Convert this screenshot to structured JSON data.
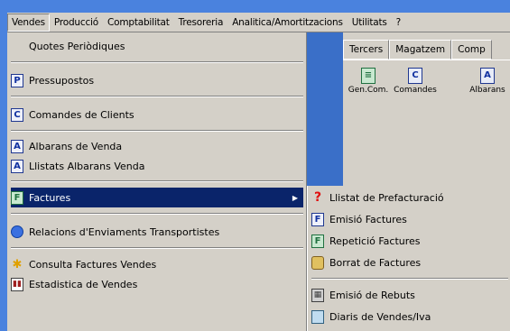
{
  "menubar": {
    "items": [
      {
        "label": "Vendes",
        "active": true
      },
      {
        "label": "Producció"
      },
      {
        "label": "Comptabilitat"
      },
      {
        "label": "Tresoreria"
      },
      {
        "label": "Analitica/Amortitzacions"
      },
      {
        "label": "Utilitats"
      },
      {
        "label": "?"
      }
    ]
  },
  "toolbar": {
    "tabs": [
      "Tercers",
      "Magatzem",
      "Comp"
    ],
    "tools": [
      {
        "label": "Gen.Com.",
        "icon": "generate-commands-icon",
        "glyph": "≡"
      },
      {
        "label": "Comandes",
        "icon": "orders-icon",
        "glyph": "C"
      },
      {
        "label": "Albarans",
        "icon": "delivery-notes-icon",
        "glyph": "A"
      }
    ]
  },
  "vendes_menu": {
    "items": [
      {
        "label": "Quotes Periòdiques",
        "icon": ""
      },
      {
        "label": "Pressupostos",
        "icon": "budget-icon",
        "glyph": "P"
      },
      {
        "label": "Comandes de Clients",
        "icon": "orders-icon",
        "glyph": "C"
      },
      {
        "label": "Albarans de Venda",
        "icon": "delivery-note-icon",
        "glyph": "A"
      },
      {
        "label": "Llistats Albarans Venda",
        "icon": "delivery-list-icon",
        "glyph": "A"
      },
      {
        "label": "Factures",
        "icon": "invoice-icon",
        "glyph": "F",
        "highlighted": true,
        "submenu": true
      },
      {
        "label": "Relacions d'Enviaments Transportistes",
        "icon": "globe-icon",
        "glyph": ""
      },
      {
        "label": "Consulta Factures Vendes",
        "icon": "runner-icon",
        "glyph": "✱"
      },
      {
        "label": "Estadistica de Vendes",
        "icon": "statistics-icon",
        "glyph": "▮▮"
      }
    ]
  },
  "factures_submenu": {
    "items": [
      {
        "label": "Llistat de Prefacturació",
        "icon": "question-icon",
        "glyph": "?"
      },
      {
        "label": "Emisió Factures",
        "icon": "invoice-icon",
        "glyph": "F"
      },
      {
        "label": "Repetició Factures",
        "icon": "repeat-invoice-icon",
        "glyph": "F"
      },
      {
        "label": "Borrat de Factures",
        "icon": "database-icon",
        "glyph": ""
      },
      {
        "label": "Emisió de Rebuts",
        "icon": "receipts-icon",
        "glyph": "▦"
      },
      {
        "label": "Diaris de Vendes/Iva",
        "icon": "journal-icon",
        "glyph": ""
      }
    ]
  },
  "colors": {
    "desktop": "#4a82de",
    "menu_bg": "#d4d0c8",
    "highlight": "#0a246a"
  }
}
